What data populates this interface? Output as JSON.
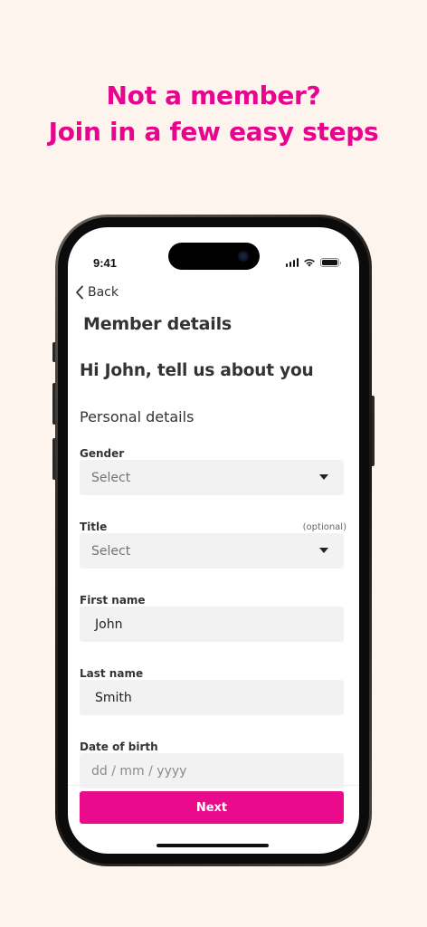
{
  "promo": {
    "line1": "Not a member?",
    "line2": "Join in a few easy steps"
  },
  "status_bar": {
    "time": "9:41"
  },
  "nav": {
    "back_label": "Back"
  },
  "screen": {
    "title": "Member details",
    "greeting": "Hi John, tell us about you",
    "section": "Personal details"
  },
  "form": {
    "gender": {
      "label": "Gender",
      "value": "Select"
    },
    "title": {
      "label": "Title",
      "optional": "(optional)",
      "value": "Select"
    },
    "first_name": {
      "label": "First name",
      "value": "John"
    },
    "last_name": {
      "label": "Last name",
      "value": "Smith"
    },
    "dob": {
      "label": "Date of birth",
      "placeholder": "dd / mm / yyyy"
    }
  },
  "footer": {
    "next_label": "Next"
  },
  "colors": {
    "accent": "#ea0a8c",
    "page_background": "#fdf4ee",
    "field_background": "#f2f2f2"
  }
}
